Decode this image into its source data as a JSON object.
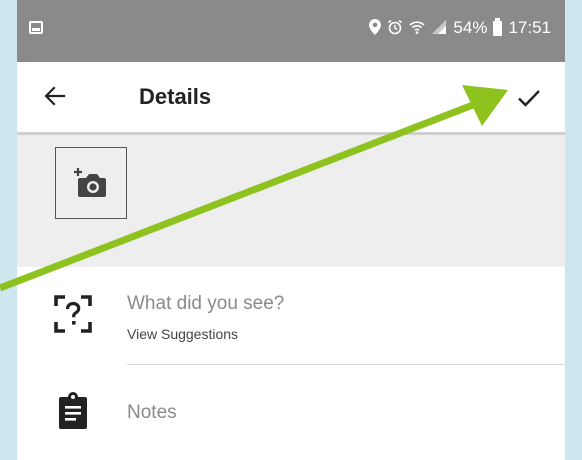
{
  "status_bar": {
    "battery_percent": "54%",
    "time": "17:51",
    "icons": [
      "notification-icon",
      "location-icon",
      "alarm-icon",
      "wifi-icon",
      "signal-icon",
      "battery-icon"
    ]
  },
  "toolbar": {
    "title": "Details",
    "back_icon": "arrow-left-icon",
    "confirm_icon": "checkmark-icon"
  },
  "photo": {
    "add_icon": "add-photo-icon"
  },
  "fields": {
    "species": {
      "placeholder": "What did you see?",
      "link": "View Suggestions",
      "icon": "species-scan-icon"
    },
    "notes": {
      "placeholder": "Notes",
      "icon": "clipboard-icon"
    }
  },
  "colors": {
    "status_bar": "#8a8a8a",
    "accent_arrow": "#8dc21f",
    "photo_area": "#eeeeee",
    "frame_background": "#cde7ef"
  }
}
